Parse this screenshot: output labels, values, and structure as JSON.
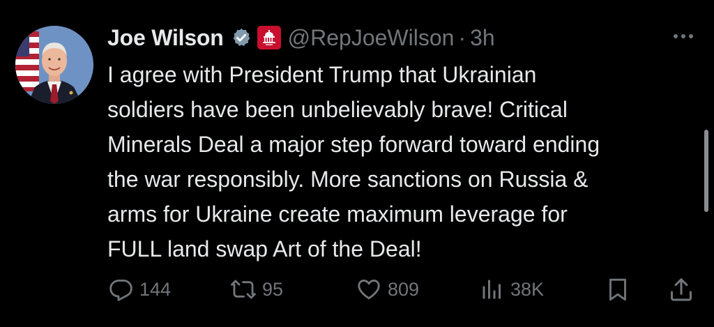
{
  "tweet": {
    "display_name": "Joe Wilson",
    "handle": "@RepJoeWilson",
    "separator": "·",
    "time": "3h",
    "body_lines": [
      "I agree with President Trump that Ukrainian",
      "soldiers have been unbelievably brave! Critical",
      "Minerals Deal a major step forward toward ending",
      "the war responsibly. More sanctions on Russia &",
      "arms for Ukraine create maximum leverage for",
      "FULL land swap Art of the Deal!"
    ]
  },
  "badges": {
    "verified_icon": "verified-badge-icon",
    "affiliation_icon": "capitol-gop-affiliation-icon",
    "affiliation_color": "#c8102e",
    "verified_color": "#829aab"
  },
  "actions": {
    "replies": "144",
    "reposts": "95",
    "likes": "809",
    "views": "38K"
  },
  "icons": {
    "reply": "reply-icon",
    "repost": "repost-icon",
    "like": "heart-icon",
    "views": "views-bar-chart-icon",
    "bookmark": "bookmark-icon",
    "share": "share-icon",
    "more": "more-options-icon"
  },
  "colors": {
    "background": "#000000",
    "primary_text": "#e7e9ea",
    "secondary_text": "#71767b"
  }
}
